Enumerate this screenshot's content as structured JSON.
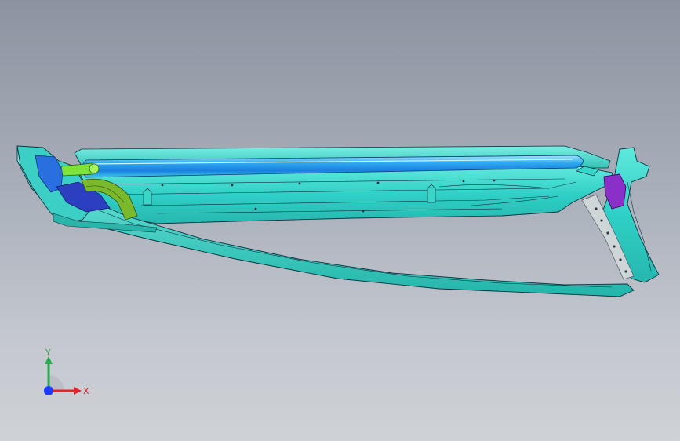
{
  "viewport": {
    "colors": {
      "bg_top": "#8c94a1",
      "bg_bottom": "#cfd2d7",
      "part_cyan": "#31d4c9",
      "part_blue": "#2a8fe8",
      "part_green": "#7ec832",
      "part_purple": "#8b2fc9",
      "part_navy": "#2c3fbf",
      "edge": "#102a3a"
    }
  },
  "triad": {
    "x_label": "X",
    "y_label": "Y",
    "x_color": "#e0242a",
    "y_color": "#22b14c",
    "z_color": "#1e3cff"
  }
}
